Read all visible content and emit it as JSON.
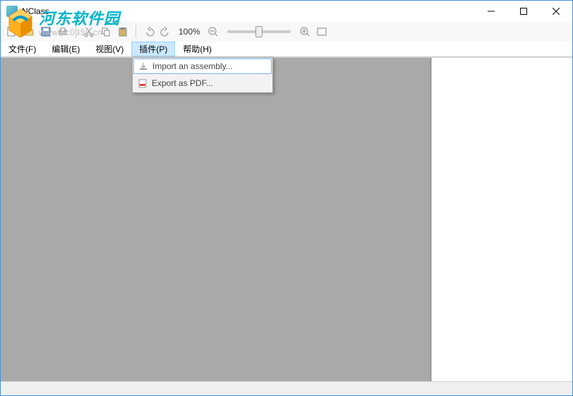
{
  "titlebar": {
    "title": "NClass"
  },
  "toolbar": {
    "zoom_text": "100%"
  },
  "menubar": {
    "file": "文件(F)",
    "edit": "编辑(E)",
    "view": "视图(V)",
    "plugins": "插件(P)",
    "help": "帮助(H)"
  },
  "dropdown": {
    "import_assembly": "Import an assembly...",
    "export_pdf": "Export as PDF..."
  },
  "watermark": {
    "cn": "河东软件园",
    "url": "www.pc0359.cn"
  }
}
